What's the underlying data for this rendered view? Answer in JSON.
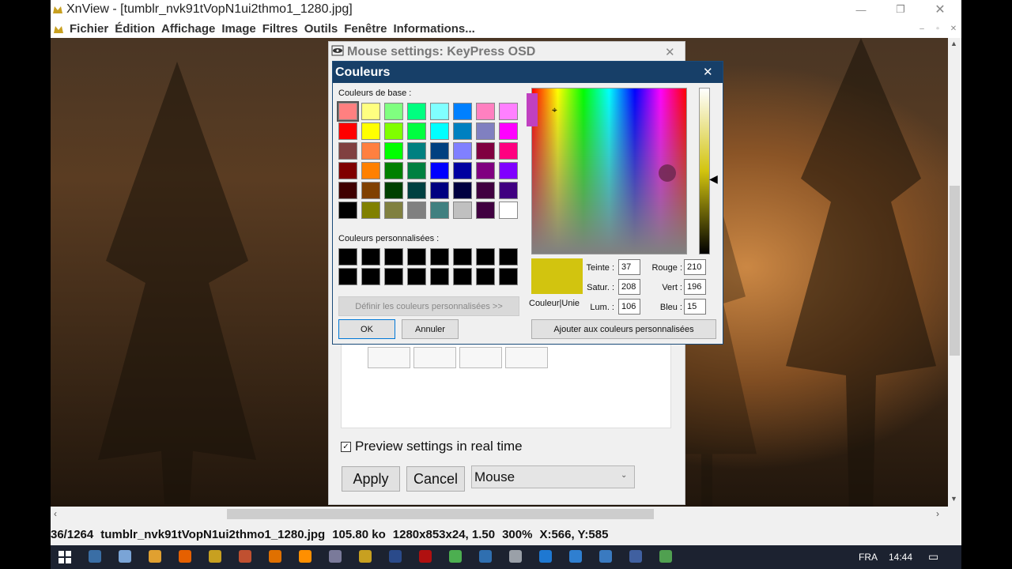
{
  "xnview": {
    "title": "XnView - [tumblr_nvk91tVopN1ui2thmo1_1280.jpg]",
    "menu": [
      "Fichier",
      "Édition",
      "Affichage",
      "Image",
      "Filtres",
      "Outils",
      "Fenêtre",
      "Informations..."
    ],
    "status": [
      "36/1264",
      "tumblr_nvk91tVopN1ui2thmo1_1280.jpg",
      "105.80 ko",
      "1280x853x24, 1.50",
      "300%",
      "X:566, Y:585"
    ]
  },
  "mouse_settings": {
    "title": "Mouse settings: KeyPress OSD",
    "preview_label": "Preview settings in real time",
    "preview_checked": true,
    "apply_label": "Apply",
    "cancel_label": "Cancel",
    "select_value": "Mouse"
  },
  "couleurs": {
    "title": "Couleurs",
    "base_label": "Couleurs de base :",
    "custom_label": "Couleurs personnalisées :",
    "define_custom_label": "Définir les couleurs personnalisées >>",
    "ok_label": "OK",
    "cancel_label": "Annuler",
    "add_custom_label": "Ajouter aux couleurs personnalisées",
    "solid_label": "Couleur|Unie",
    "selected_color": "#d2c40f",
    "fields": {
      "teinte_label": "Teinte :",
      "teinte": "37",
      "satur_label": "Satur. :",
      "satur": "208",
      "lum_label": "Lum. :",
      "lum": "106",
      "rouge_label": "Rouge :",
      "rouge": "210",
      "vert_label": "Vert :",
      "vert": "196",
      "bleu_label": "Bleu :",
      "bleu": "15"
    },
    "base_colors": [
      [
        "#ff8080",
        "#ffff80",
        "#80ff80",
        "#00ff80",
        "#80ffff",
        "#0080ff",
        "#ff80c0",
        "#ff80ff"
      ],
      [
        "#ff0000",
        "#ffff00",
        "#80ff00",
        "#00ff40",
        "#00ffff",
        "#0080c0",
        "#8080c0",
        "#ff00ff"
      ],
      [
        "#804040",
        "#ff8040",
        "#00ff00",
        "#008080",
        "#004080",
        "#8080ff",
        "#800040",
        "#ff0080"
      ],
      [
        "#800000",
        "#ff8000",
        "#008000",
        "#008040",
        "#0000ff",
        "#0000a0",
        "#800080",
        "#8000ff"
      ],
      [
        "#400000",
        "#804000",
        "#004000",
        "#004040",
        "#000080",
        "#000040",
        "#400040",
        "#400080"
      ],
      [
        "#000000",
        "#808000",
        "#808040",
        "#808080",
        "#408080",
        "#c0c0c0",
        "#400040",
        "#ffffff"
      ]
    ]
  },
  "taskbar": {
    "lang": "FRA",
    "time": "14:44",
    "icons": [
      "start-icon",
      "task-view-icon",
      "file-explorer-icon",
      "firefox-icon",
      "xnview-icon",
      "git-icon",
      "vlc-icon",
      "sublime-icon",
      "obs-icon",
      "xnview-icon",
      "photoshop-icon",
      "filezilla-icon",
      "chrome-icon",
      "remote-desktop-icon",
      "settings-icon",
      "edge-icon",
      "network-icon",
      "terminal-icon",
      "notepad-icon",
      "app-icon",
      "keypress-icon"
    ]
  }
}
